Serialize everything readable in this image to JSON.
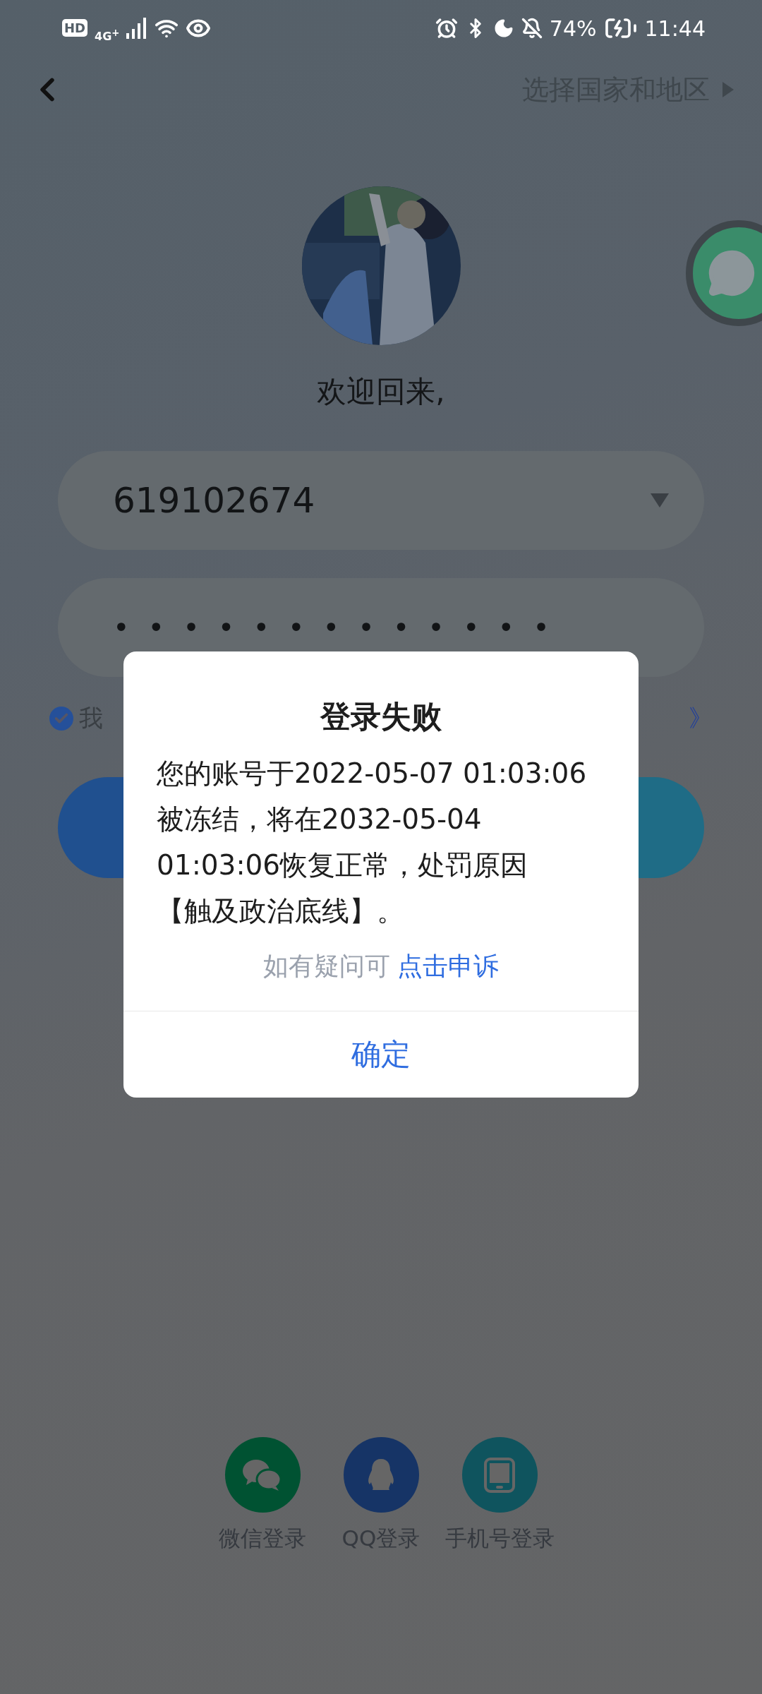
{
  "status_bar": {
    "network_badge": "HD",
    "network_type": "4G$^{+}$",
    "battery": "74%",
    "time": "11:44"
  },
  "header": {
    "region_link": "选择国家和地区"
  },
  "welcome": "欢迎回来,",
  "account": {
    "value": "619102674"
  },
  "password": {
    "value": "•••••••••••••"
  },
  "agreement": {
    "checked": true,
    "text_start": "我",
    "text_end": "》"
  },
  "dialog": {
    "title": "登录失败",
    "message": "您的账号于2022-05-07 01:03:06 被冻结，将在2032-05-04 01:03:06恢复正常，处罚原因【触及政治底线】。",
    "hint": "如有疑问可",
    "appeal_link": "点击申诉",
    "confirm": "确定"
  },
  "third_party": [
    {
      "kind": "wechat",
      "label": "微信登录",
      "color": "#005232"
    },
    {
      "kind": "qq",
      "label": "QQ登录",
      "color": "#163466"
    },
    {
      "kind": "phone",
      "label": "手机号登录",
      "color": "#0f545e"
    }
  ]
}
